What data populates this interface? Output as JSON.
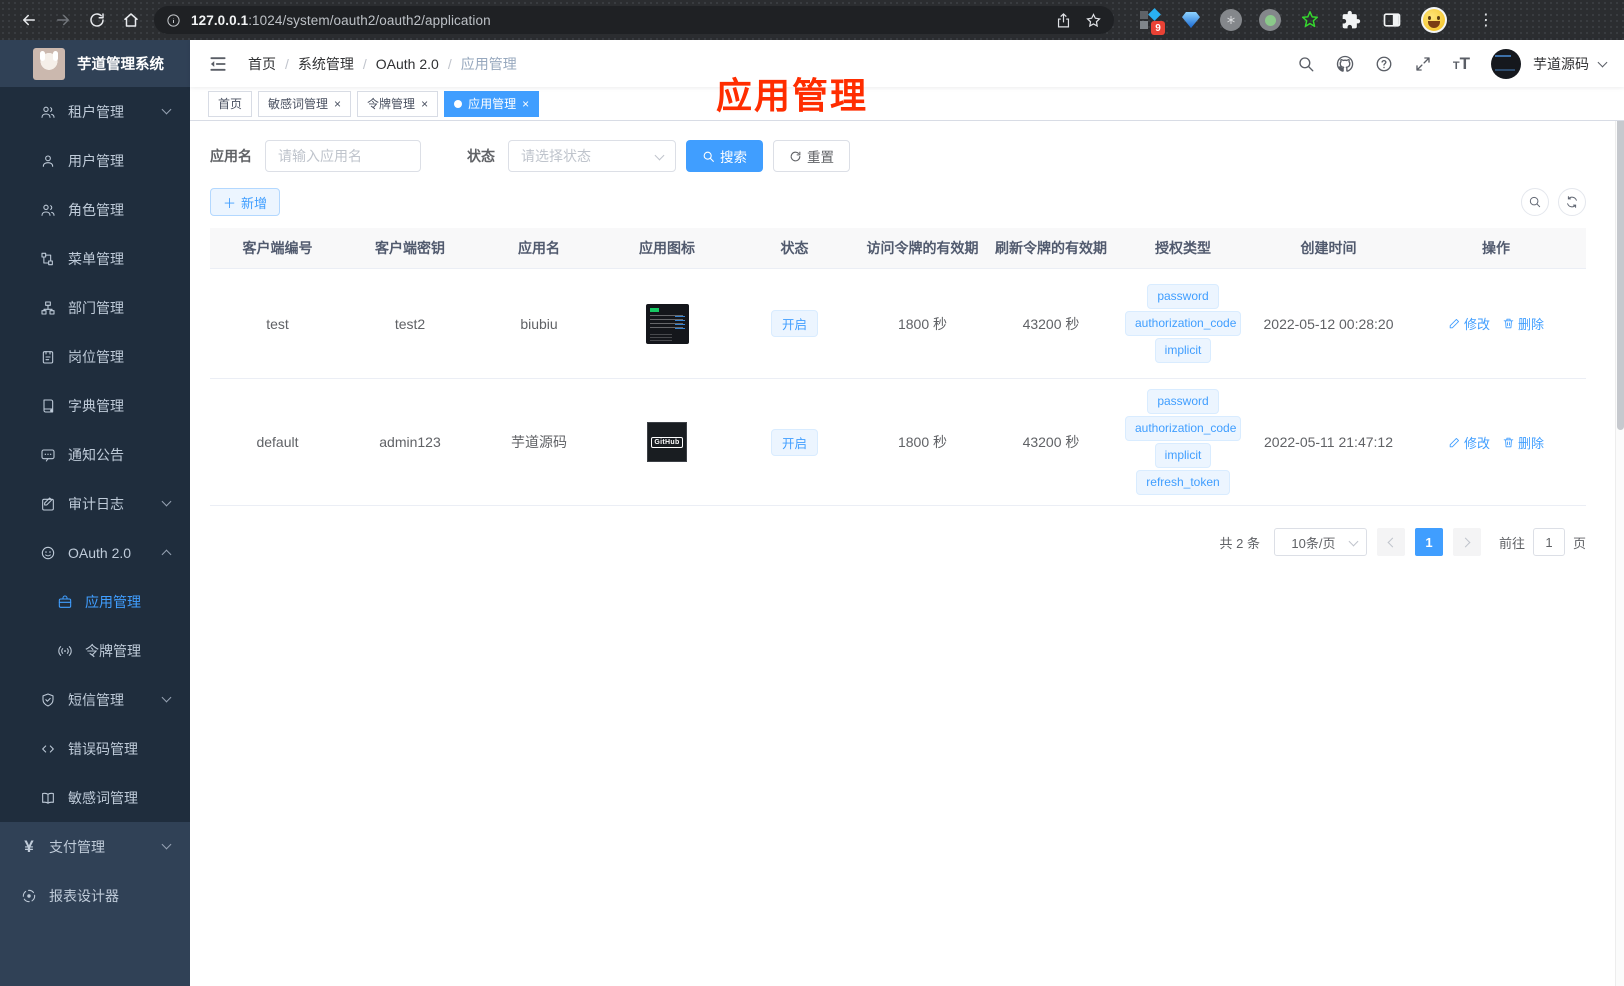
{
  "browser": {
    "url_host": "127.0.0.1",
    "url_path": ":1024/system/oauth2/oauth2/application",
    "extension_badge": "9"
  },
  "sidebar": {
    "app_title": "芋道管理系统",
    "items": [
      {
        "label": "租户管理"
      },
      {
        "label": "用户管理"
      },
      {
        "label": "角色管理"
      },
      {
        "label": "菜单管理"
      },
      {
        "label": "部门管理"
      },
      {
        "label": "岗位管理"
      },
      {
        "label": "字典管理"
      },
      {
        "label": "通知公告"
      },
      {
        "label": "审计日志"
      },
      {
        "label": "OAuth 2.0"
      },
      {
        "label": "应用管理"
      },
      {
        "label": "令牌管理"
      },
      {
        "label": "短信管理"
      },
      {
        "label": "错误码管理"
      },
      {
        "label": "敏感词管理"
      },
      {
        "label": "支付管理"
      },
      {
        "label": "报表设计器"
      }
    ]
  },
  "navbar": {
    "breadcrumb": [
      "首页",
      "系统管理",
      "OAuth 2.0",
      "应用管理"
    ],
    "username": "芋道源码"
  },
  "tabs": [
    {
      "label": "首页"
    },
    {
      "label": "敏感词管理"
    },
    {
      "label": "令牌管理"
    },
    {
      "label": "应用管理"
    }
  ],
  "annotation": {
    "text": "应用管理"
  },
  "filter": {
    "name_label": "应用名",
    "name_placeholder": "请输入应用名",
    "status_label": "状态",
    "status_placeholder": "请选择状态",
    "search_label": "搜索",
    "reset_label": "重置",
    "add_label": "新增"
  },
  "table": {
    "columns": [
      "客户端编号",
      "客户端密钥",
      "应用名",
      "应用图标",
      "状态",
      "访问令牌的有效期",
      "刷新令牌的有效期",
      "授权类型",
      "创建时间",
      "操作"
    ],
    "rows": [
      {
        "client_id": "test",
        "secret": "test2",
        "name": "biubiu",
        "icon": "terminal-screenshot",
        "status": "开启",
        "access_ttl": "1800 秒",
        "refresh_ttl": "43200 秒",
        "grant_types": [
          "password",
          "authorization_code",
          "implicit"
        ],
        "created": "2022-05-12 00:28:20",
        "edit": "修改",
        "delete": "删除"
      },
      {
        "client_id": "default",
        "secret": "admin123",
        "name": "芋道源码",
        "icon": "github-logo",
        "icon_text": "GitHub",
        "status": "开启",
        "access_ttl": "1800 秒",
        "refresh_ttl": "43200 秒",
        "grant_types": [
          "password",
          "authorization_code",
          "implicit",
          "refresh_token"
        ],
        "created": "2022-05-11 21:47:12",
        "edit": "修改",
        "delete": "删除"
      }
    ]
  },
  "pagination": {
    "total": "共 2 条",
    "page_size": "10条/页",
    "page": "1",
    "goto_label": "前往",
    "goto_value": "1",
    "goto_suffix": "页"
  },
  "colors": {
    "accent": "#409eff",
    "sidebar_bg": "#304156",
    "submenu_bg": "#1f2d3d",
    "tag_bg": "#ecf5ff",
    "annotation_red": "#ff2d00"
  }
}
